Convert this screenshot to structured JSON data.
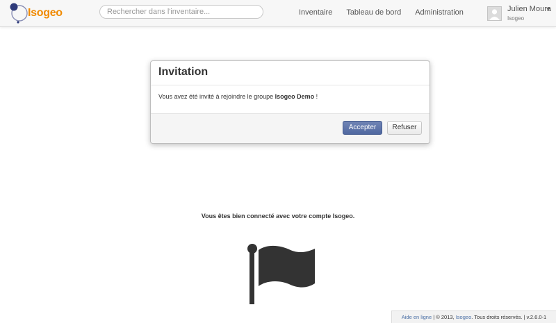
{
  "app": {
    "logo_text": "Isogeo",
    "brand_color": "#f08a00"
  },
  "search": {
    "placeholder": "Rechercher dans l'inventaire..."
  },
  "nav": {
    "items": [
      {
        "label": "Inventaire"
      },
      {
        "label": "Tableau de bord"
      },
      {
        "label": "Administration"
      }
    ]
  },
  "user": {
    "name": "Julien Moura",
    "organization": "Isogeo",
    "avatar_icon": "user-silhouette-icon"
  },
  "modal": {
    "title": "Invitation",
    "body_prefix": "Vous avez été invité à rejoindre le groupe ",
    "group_name": "Isogeo Demo",
    "body_suffix": " !",
    "accept_label": "Accepter",
    "refuse_label": "Refuser",
    "accept_color": "#5a70a8"
  },
  "main": {
    "connected_message": "Vous êtes bien connecté avec votre compte Isogeo.",
    "illustration_icon": "flag-icon"
  },
  "footer": {
    "help_link": "Aide en ligne",
    "sep1": " | © 2013, ",
    "company_link": "Isogeo",
    "rights": ". Tous droits réservés. | v.2.6.0-1"
  }
}
